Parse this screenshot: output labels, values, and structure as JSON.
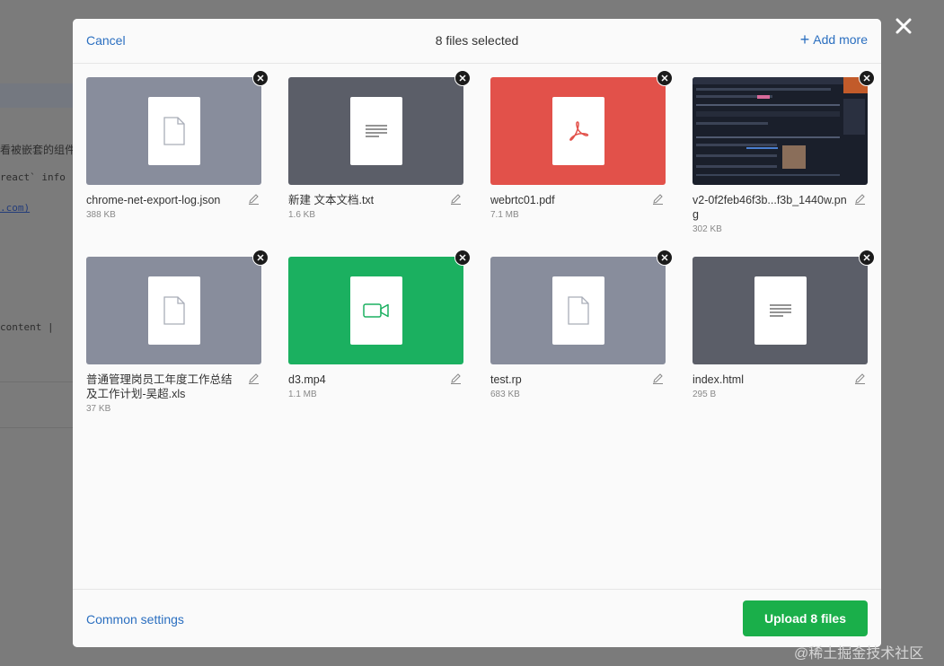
{
  "background_page": {
    "line1": "看被嵌套的组件",
    "line2": "react` info",
    "line3": ".com)",
    "line4": "content |"
  },
  "modal": {
    "cancel_label": "Cancel",
    "title": "8 files selected",
    "add_more_label": "Add more",
    "add_more_icon": "plus-icon",
    "common_settings_label": "Common settings",
    "upload_button_label": "Upload 8 files"
  },
  "files": [
    {
      "name": "chrome-net-export-log.json",
      "size": "388 KB",
      "kind": "generic",
      "icon": "file-icon"
    },
    {
      "name": "新建 文本文档.txt",
      "size": "1.6 KB",
      "kind": "text",
      "icon": "text-lines-icon"
    },
    {
      "name": "webrtc01.pdf",
      "size": "7.1 MB",
      "kind": "pdf",
      "icon": "pdf-icon"
    },
    {
      "name": "v2-0f2feb46f3b...f3b_1440w.png",
      "size": "302 KB",
      "kind": "image",
      "icon": "image-thumbnail"
    },
    {
      "name": "普通管理岗员工年度工作总结及工作计划-吴超.xls",
      "size": "37 KB",
      "kind": "generic",
      "icon": "file-icon"
    },
    {
      "name": "d3.mp4",
      "size": "1.1 MB",
      "kind": "video",
      "icon": "video-camera-icon"
    },
    {
      "name": "test.rp",
      "size": "683 KB",
      "kind": "generic",
      "icon": "file-icon"
    },
    {
      "name": "index.html",
      "size": "295 B",
      "kind": "text",
      "icon": "text-lines-icon"
    }
  ],
  "watermark": "@稀土掘金技术社区",
  "colors": {
    "link": "#2b6fc0",
    "upload_button": "#1aaf4a",
    "generic_thumb": "#888d9c",
    "text_thumb": "#5b5e68",
    "pdf_thumb": "#e2514a",
    "video_thumb": "#1bb060"
  }
}
